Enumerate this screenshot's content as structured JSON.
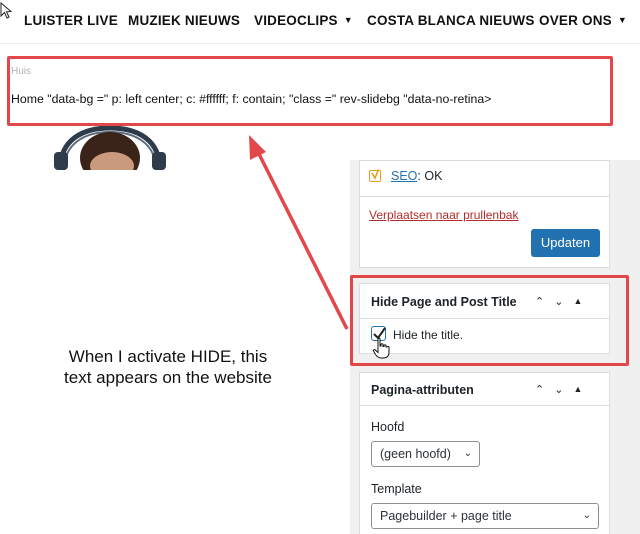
{
  "nav": {
    "items": [
      {
        "label": "LUISTER LIVE",
        "dropdown": false
      },
      {
        "label": "MUZIEK NIEUWS",
        "dropdown": false
      },
      {
        "label": "VIDEOCLIPS",
        "dropdown": true
      },
      {
        "label": "COSTA BLANCA NIEUWS",
        "dropdown": false
      },
      {
        "label": "OVER ONS",
        "dropdown": true
      }
    ]
  },
  "page": {
    "breadcrumb": "Huis",
    "leaked_text": "Home \"data-bg =\" p: left center; c: #ffffff; f: contain; \"class =\" rev-slidebg \"data-no-retina>"
  },
  "annotation": {
    "line1": "When I activate HIDE, this",
    "line2": "text appears on the website"
  },
  "sidebar": {
    "publish": {
      "seo_link": "SEO",
      "seo_status": ": OK",
      "trash_link": "Verplaatsen naar prullenbak",
      "update_button": "Updaten"
    },
    "hide_title_panel": {
      "title": "Hide Page and Post Title",
      "checkbox_label": "Hide the title.",
      "checked": true
    },
    "page_attributes": {
      "title": "Pagina-attributen",
      "parent_label": "Hoofd",
      "parent_value": "(geen hoofd)",
      "template_label": "Template",
      "template_value": "Pagebuilder + page title"
    }
  },
  "colors": {
    "highlight_red": "#e4474a",
    "wp_blue": "#2271b1",
    "trash_red": "#b32d2e"
  },
  "icons": [
    "cursor-arrow-icon",
    "chevron-down-icon",
    "yoast-icon",
    "chevron-up-icon",
    "triangle-up-icon",
    "checkmark-icon",
    "hand-pointer-icon"
  ]
}
